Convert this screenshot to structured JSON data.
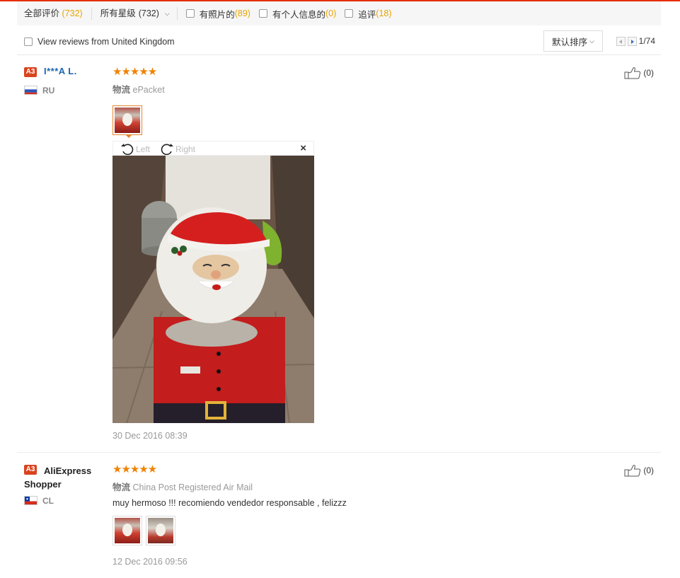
{
  "filters": {
    "all_label": "全部评价",
    "all_count": "(732)",
    "stars_label": "所有星级",
    "stars_count": "(732)",
    "photos_label": "有照片的",
    "photos_count": "(89)",
    "personal_label": "有个人信息的",
    "personal_count": "(0)",
    "followup_label": "追评",
    "followup_count": "(18)"
  },
  "uk_filter": {
    "label": "View reviews from United Kingdom"
  },
  "sort": {
    "label": "默认排序"
  },
  "pager": {
    "text": "1/74"
  },
  "reviews": [
    {
      "badge": "A3",
      "name": "I***A L.",
      "country": "RU",
      "stars": "★★★★★",
      "logistics_label": "物流",
      "logistics": "ePacket",
      "likes": "(0)",
      "viewer": {
        "left_label": "Left",
        "right_label": "Right",
        "close": "×"
      },
      "date": "30 Dec 2016 08:39"
    },
    {
      "badge": "A3",
      "name": "AliExpress Shopper",
      "country": "CL",
      "stars": "★★★★★",
      "logistics_label": "物流",
      "logistics": "China Post Registered Air Mail",
      "likes": "(0)",
      "comment": "muy hermoso !!! recomiendo vendedor responsable , felizzz",
      "date": "12 Dec 2016 09:56"
    }
  ],
  "colors": {
    "accent": "#e62e04",
    "star": "#f08200",
    "count": "#e8a400",
    "link": "#1a66b3"
  }
}
